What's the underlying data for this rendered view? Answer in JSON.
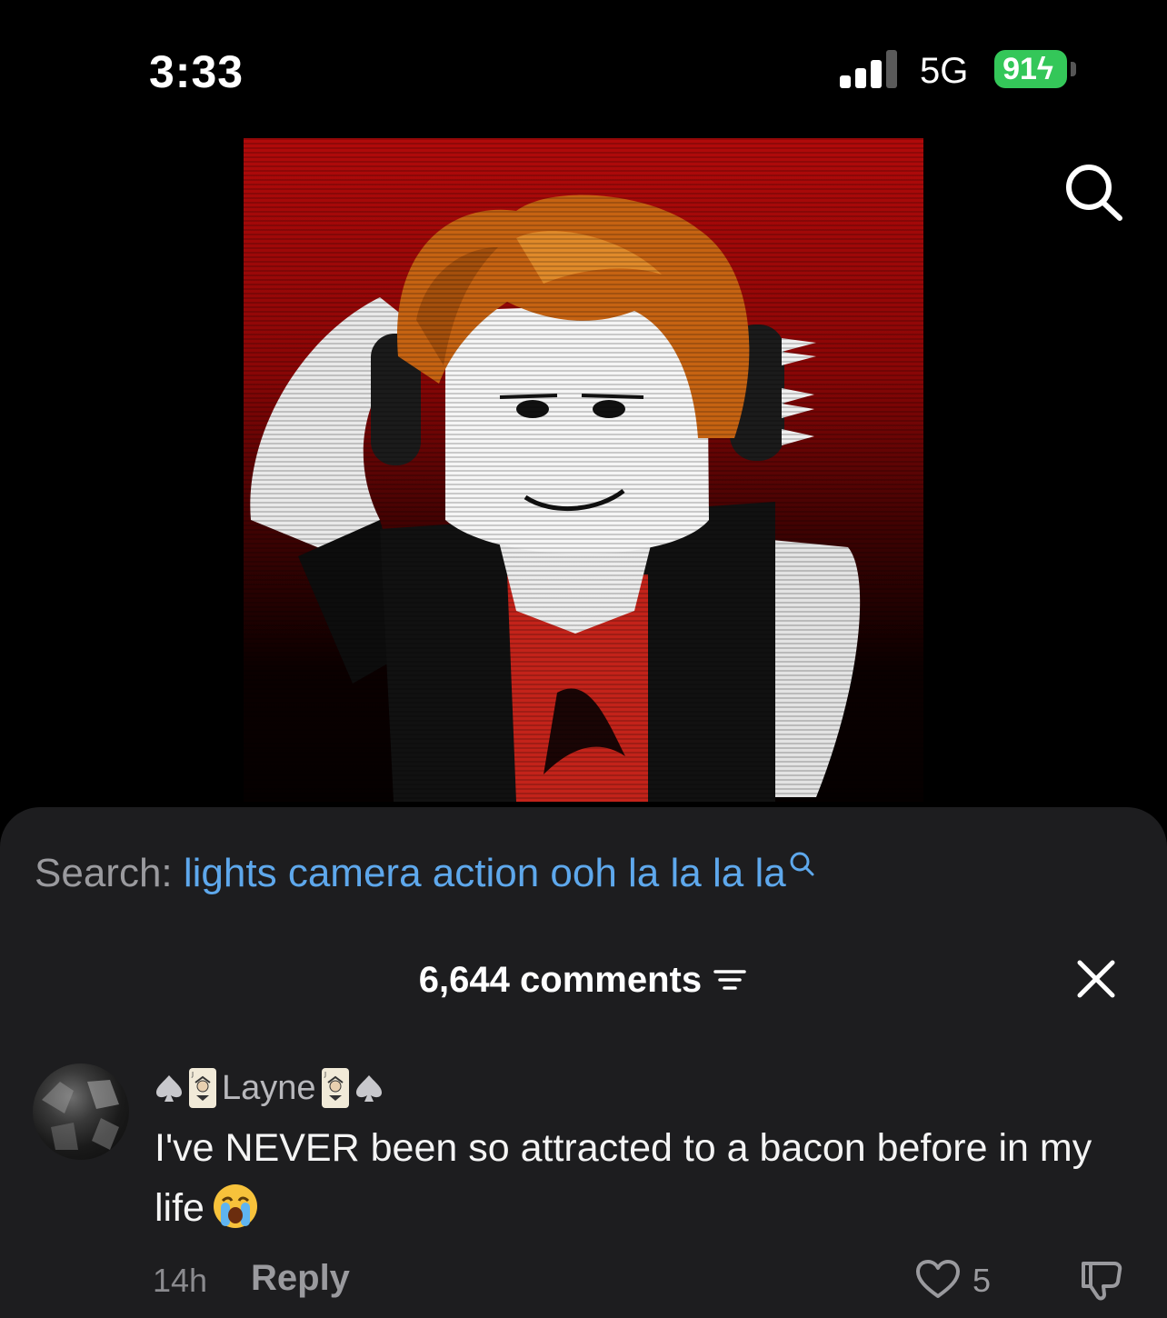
{
  "status_bar": {
    "time": "3:33",
    "network": "5G",
    "battery": "91",
    "battery_color": "#34c759"
  },
  "top_right_icon": "search-icon",
  "video": {
    "background_colors": [
      "#b10a0a",
      "#050000"
    ]
  },
  "search": {
    "label": "Search:",
    "query": "lights camera action ooh la la la la",
    "query_color": "#5ea8ec"
  },
  "comments_header": {
    "count_label": "6,644 comments",
    "sort_icon": "filter-icon",
    "close_icon": "close-icon"
  },
  "comment": {
    "username": "Layne",
    "username_decorations": [
      "spade-icon",
      "joker-card-icon",
      "joker-card-icon",
      "spade-icon"
    ],
    "text": "I've NEVER been so attracted to a bacon before in my life",
    "emoji": "loudly-crying-face-emoji",
    "time_ago": "14h",
    "reply_label": "Reply",
    "like_count": "5"
  }
}
